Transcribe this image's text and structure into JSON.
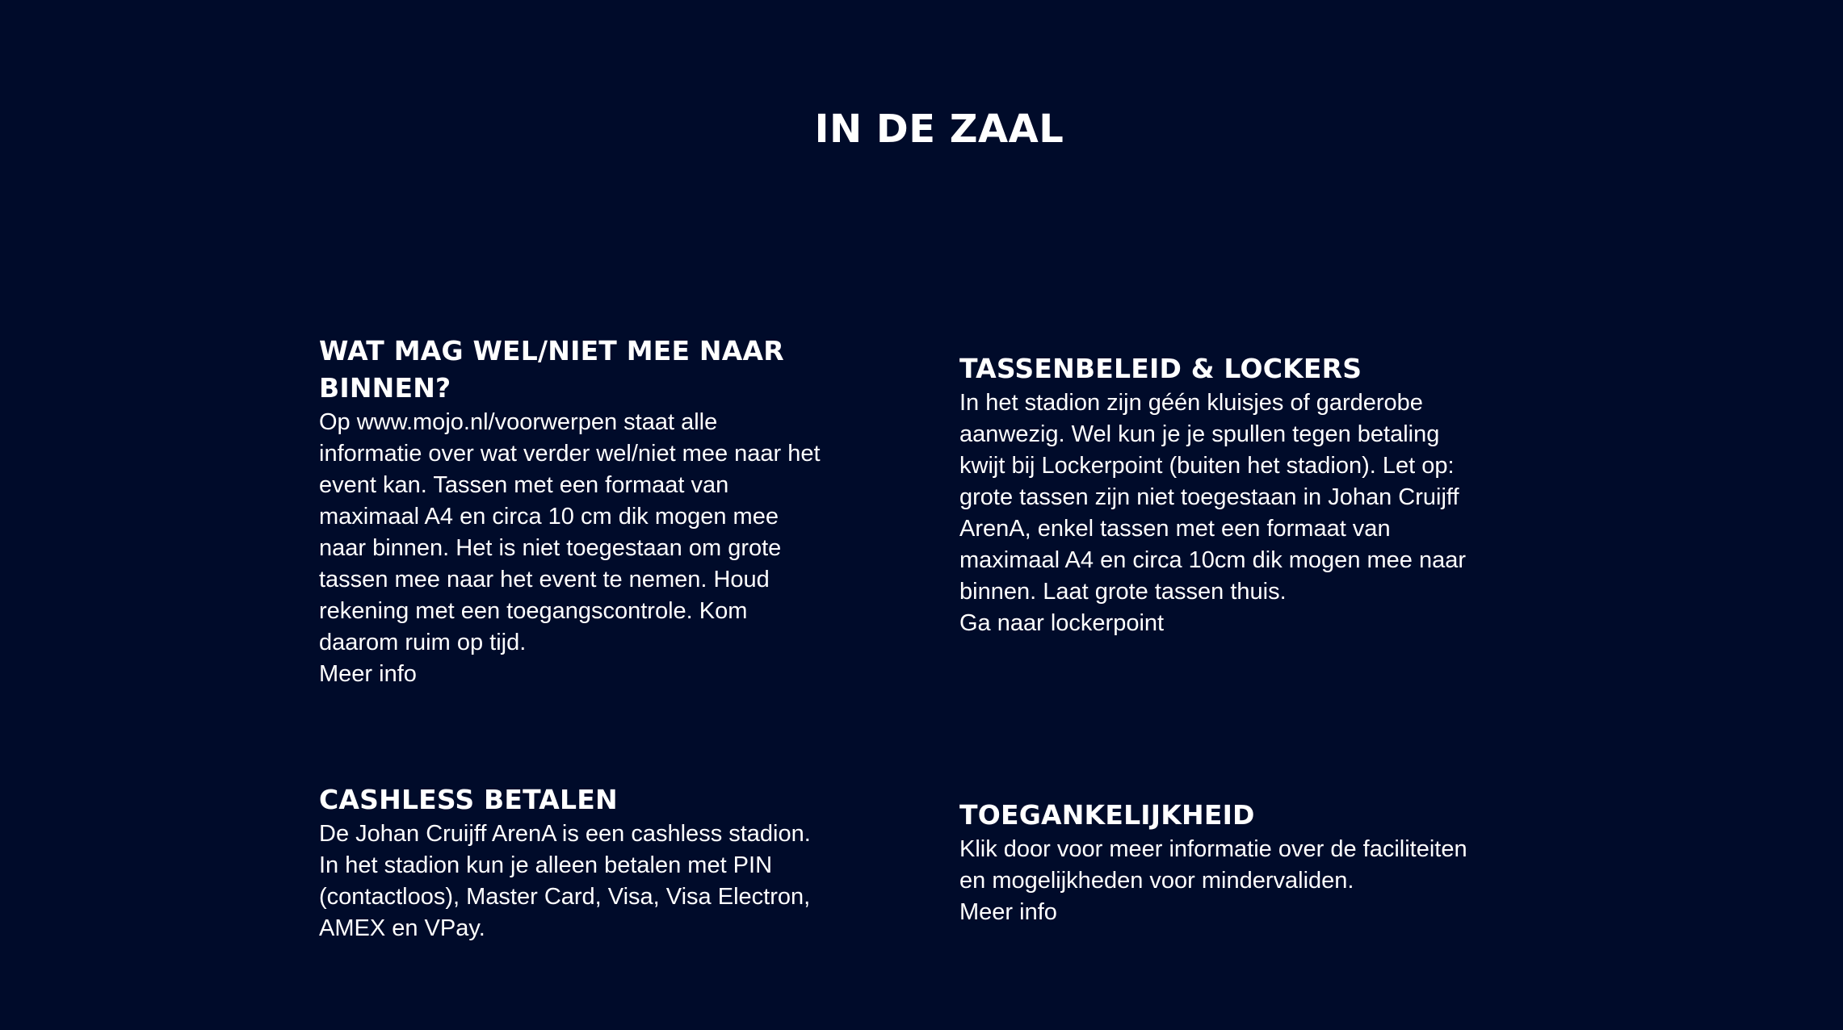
{
  "page": {
    "title": "IN DE ZAAL"
  },
  "sections": [
    {
      "heading": "WAT MAG WEL/NIET MEE NAAR BINNEN?",
      "body": "Op www.mojo.nl/voorwerpen staat alle informatie over wat verder wel/niet mee naar het event kan. Tassen met een formaat van maximaal A4 en circa 10 cm dik mogen mee naar binnen. Het is niet toegestaan om grote tassen mee naar het event te nemen. Houd rekening met een toegangscontrole. Kom daarom ruim op tijd.",
      "link": "Meer info"
    },
    {
      "heading": "TASSENBELEID & LOCKERS",
      "body": "In het stadion zijn géén kluisjes of garderobe aanwezig. Wel kun je je spullen tegen betaling kwijt bij Lockerpoint (buiten het stadion). Let op: grote tassen zijn niet toegestaan in Johan Cruijff ArenA, enkel tassen met een formaat van maximaal A4 en circa 10cm dik mogen mee naar binnen. Laat grote tassen thuis.",
      "link": "Ga naar lockerpoint"
    },
    {
      "heading": "CASHLESS BETALEN",
      "body": "De Johan Cruijff ArenA is een cashless stadion. In het stadion kun je alleen betalen met PIN (contactloos), Master Card, Visa, Visa Electron, AMEX en VPay."
    },
    {
      "heading": "TOEGANKELIJKHEID",
      "body": "Klik door voor meer informatie over de faciliteiten en mogelijkheden voor mindervaliden.",
      "link": "Meer info"
    }
  ],
  "colors": {
    "background": "#000b2a",
    "text": "#ffffff"
  }
}
